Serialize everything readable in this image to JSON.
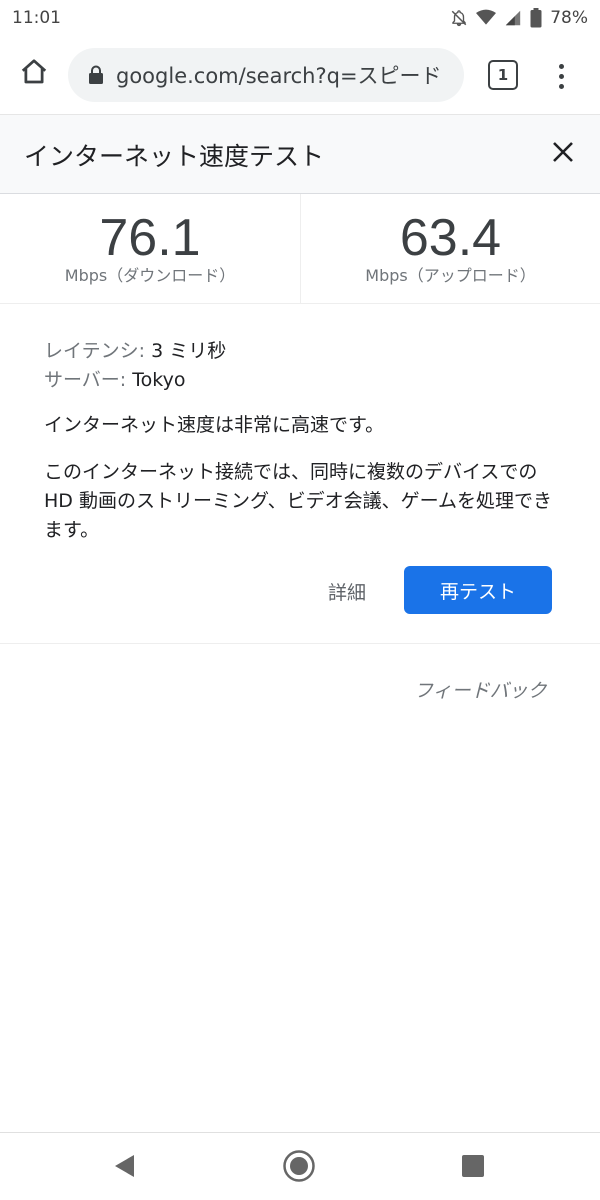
{
  "status_bar": {
    "time": "11:01",
    "battery": "78%"
  },
  "toolbar": {
    "url": "google.com/search?q=スピード",
    "tab_count": "1"
  },
  "header": {
    "title": "インターネット速度テスト"
  },
  "results": {
    "download_value": "76.1",
    "download_label": "Mbps（ダウンロード）",
    "upload_value": "63.4",
    "upload_label": "Mbps（アップロード）"
  },
  "info": {
    "latency_key": "レイテンシ:",
    "latency_value": " 3 ミリ秒",
    "server_key": "サーバー:",
    "server_value": " Tokyo",
    "summary": "インターネット速度は非常に高速です。",
    "description": "このインターネット接続では、同時に複数のデバイスでの HD 動画のストリーミング、ビデオ会議、ゲームを処理できます。",
    "details_label": "詳細",
    "retest_label": "再テスト"
  },
  "feedback": "フィードバック",
  "icons": {
    "home": "home-icon",
    "lock": "lock-icon",
    "menu": "more-vert-icon",
    "close": "close-icon",
    "back": "back-icon",
    "nav_home": "home-circle-icon",
    "recent": "recent-apps-icon"
  },
  "colors": {
    "accent": "#1a73e8"
  }
}
